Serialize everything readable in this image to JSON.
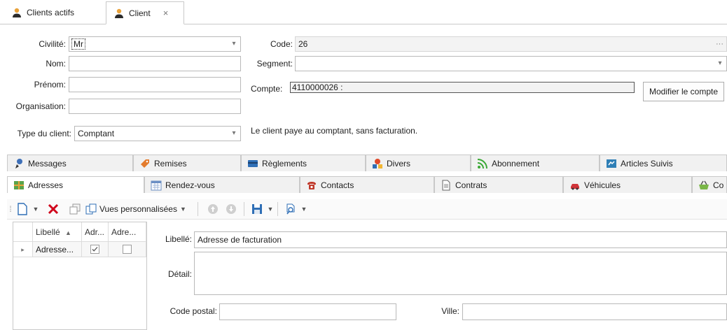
{
  "top_tabs": [
    {
      "label": "Clients actifs",
      "icon": "person-icon",
      "active": false
    },
    {
      "label": "Client",
      "icon": "person-icon",
      "active": true,
      "close": "×"
    }
  ],
  "form": {
    "civilite": {
      "label": "Civilité:",
      "value": "Mr"
    },
    "nom": {
      "label": "Nom:",
      "value": ""
    },
    "prenom": {
      "label": "Prénom:",
      "value": ""
    },
    "organisation": {
      "label": "Organisation:",
      "value": ""
    },
    "type_client": {
      "label": "Type du client:",
      "value": "Comptant"
    },
    "code": {
      "label": "Code:",
      "value": "26",
      "ellipsis": "···"
    },
    "segment": {
      "label": "Segment:",
      "value": ""
    },
    "compte": {
      "label": "Compte:",
      "value": "4110000026 :"
    },
    "modifier_compte": "Modifier le compte",
    "type_description": "Le client paye au comptant, sans facturation."
  },
  "tabs_row1": [
    {
      "label": "Messages",
      "icon": "messages-icon"
    },
    {
      "label": "Remises",
      "icon": "discount-tag-icon"
    },
    {
      "label": "Règlements",
      "icon": "credit-card-icon"
    },
    {
      "label": "Divers",
      "icon": "shapes-icon"
    },
    {
      "label": "Abonnement",
      "icon": "rss-icon"
    },
    {
      "label": "Articles Suivis",
      "icon": "tracked-items-icon"
    }
  ],
  "tabs_row2": [
    {
      "label": "Adresses",
      "icon": "map-icon",
      "active": true
    },
    {
      "label": "Rendez-vous",
      "icon": "calendar-icon"
    },
    {
      "label": "Contacts",
      "icon": "phone-icon"
    },
    {
      "label": "Contrats",
      "icon": "document-icon"
    },
    {
      "label": "Véhicules",
      "icon": "car-icon"
    },
    {
      "label": "Co",
      "icon": "basket-icon"
    }
  ],
  "toolbar": {
    "views_label": "Vues personnalisées",
    "colors": {
      "delete": "#d0021b",
      "accent": "#2f6fb6"
    }
  },
  "grid": {
    "columns": [
      "Libellé",
      "Adr...",
      "Adre..."
    ],
    "rows": [
      {
        "libelle": "Adresse...",
        "col2_checked": true,
        "col3_checked": false
      }
    ]
  },
  "detail": {
    "libelle": {
      "label": "Libellé:",
      "value": "Adresse de facturation"
    },
    "detail": {
      "label": "Détail:",
      "value": ""
    },
    "code_postal": {
      "label": "Code postal:",
      "value": ""
    },
    "ville": {
      "label": "Ville:",
      "value": ""
    }
  }
}
